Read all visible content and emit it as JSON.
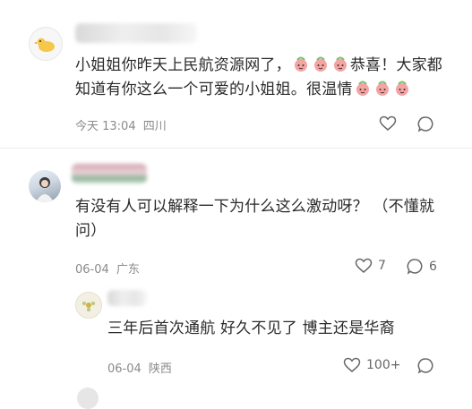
{
  "comments": [
    {
      "text_a": "小姐姐你昨天上民航资源网了，",
      "text_b": "恭喜！大家都",
      "text_c": "知道有你这么一个可爱的小姐姐。很温情",
      "time": "今天 13:04",
      "location": "四川",
      "peach_emoji_count_1": 3,
      "peach_emoji_count_2": 3
    },
    {
      "text_a": "有没有人可以解释一下为什么这么激动呀？ （不懂就",
      "text_b": "问）",
      "date": "06-04",
      "location": "广东",
      "likes": "7",
      "replies": "6"
    },
    {
      "text": "三年后首次通航 好久不见了 博主还是华裔",
      "date": "06-04",
      "location": "陕西",
      "likes": "100+"
    }
  ],
  "icons": {
    "like": "heart-outline-icon",
    "reply": "speech-bubble-icon",
    "emoji": "peach-emoji-icon"
  },
  "colors": {
    "meta_text": "#8a8a8a",
    "peach": "#f58e8e"
  }
}
